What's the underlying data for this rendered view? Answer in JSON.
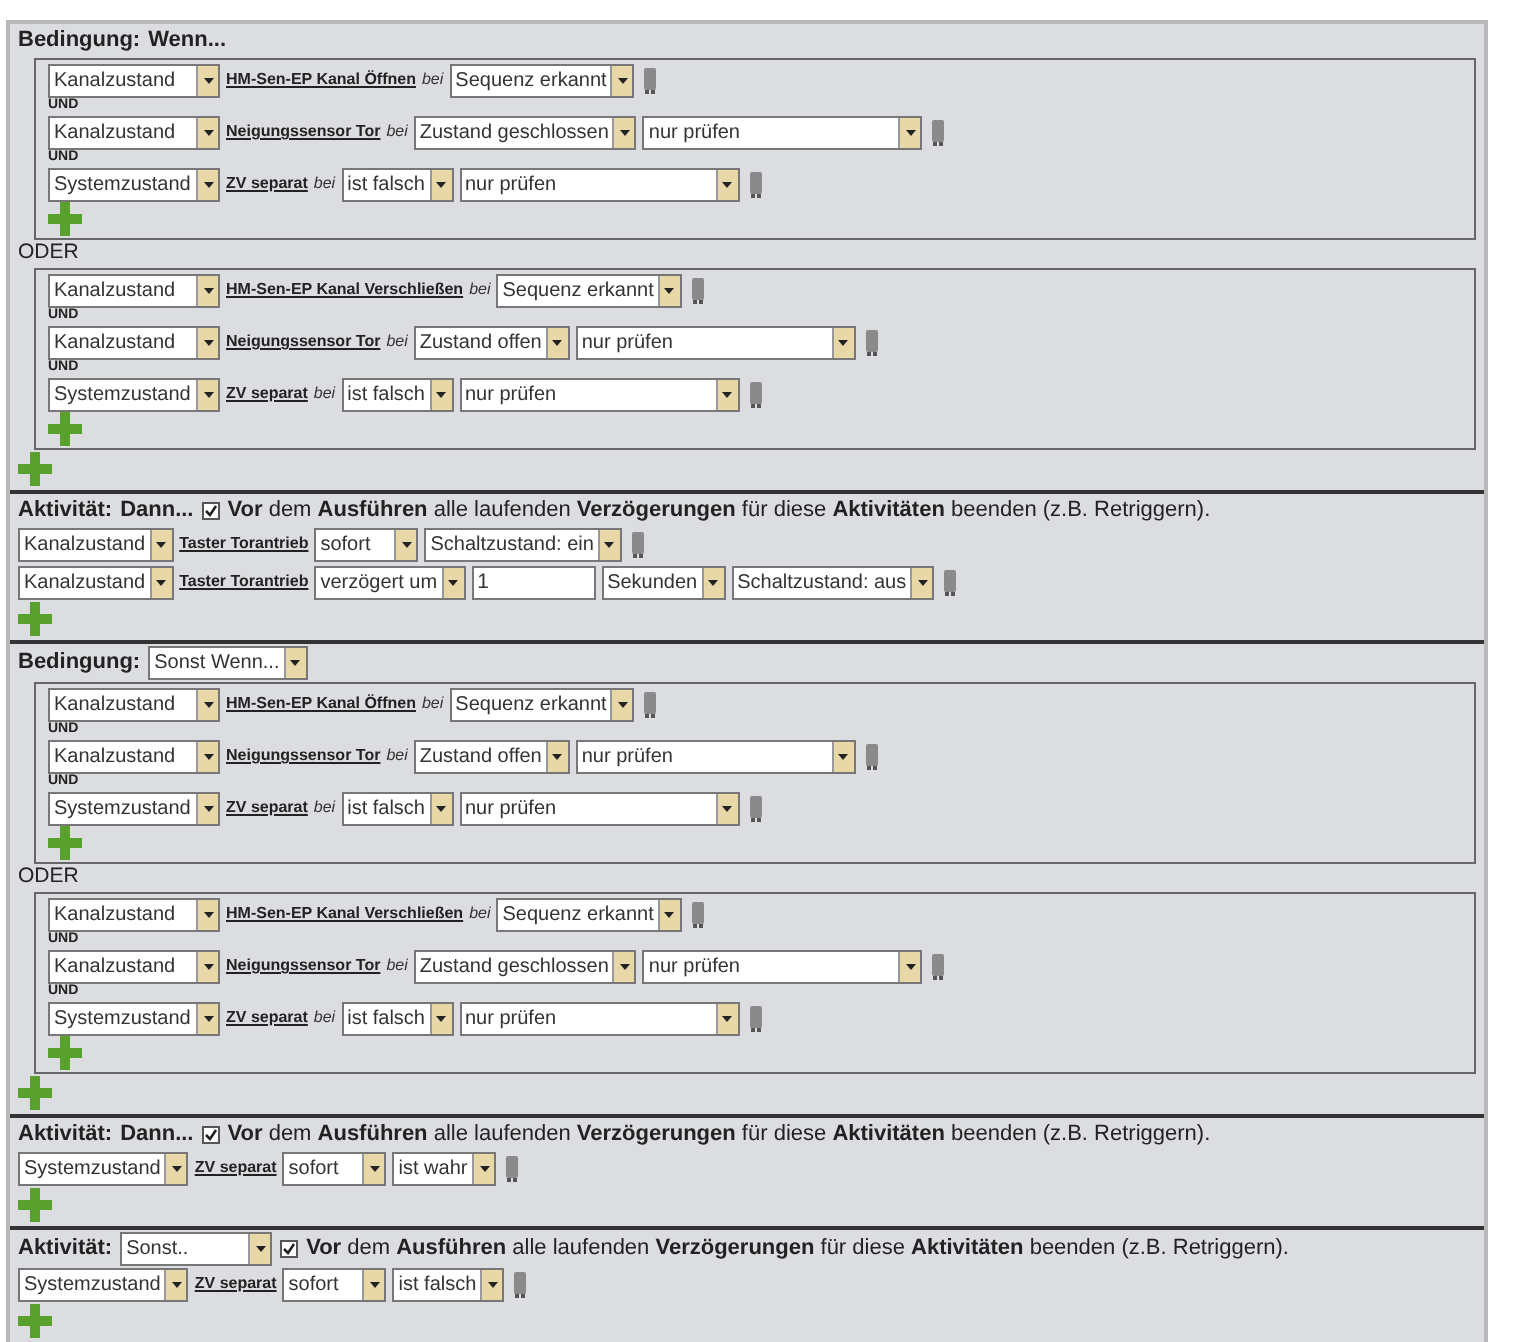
{
  "sections": [
    {
      "kind": "condition",
      "label": "Bedingung:",
      "mode": {
        "kind": "text",
        "value": "Wenn..."
      },
      "groups": [
        {
          "rows": [
            {
              "items": [
                {
                  "kind": "select",
                  "value": "Kanalzustand"
                },
                {
                  "kind": "link",
                  "text": "HM-Sen-EP Kanal Öffnen"
                },
                {
                  "kind": "note",
                  "text": "bei"
                },
                {
                  "kind": "select",
                  "value": "Sequenz erkannt"
                }
              ]
            },
            {
              "prefix": "UND",
              "items": [
                {
                  "kind": "select",
                  "value": "Kanalzustand"
                },
                {
                  "kind": "link",
                  "text": "Neigungssensor Tor"
                },
                {
                  "kind": "note",
                  "text": "bei"
                },
                {
                  "kind": "select",
                  "value": "Zustand geschlossen"
                },
                {
                  "kind": "select",
                  "value": "nur prüfen"
                }
              ]
            },
            {
              "prefix": "UND",
              "items": [
                {
                  "kind": "select",
                  "value": "Systemzustand"
                },
                {
                  "kind": "link",
                  "text": "ZV separat"
                },
                {
                  "kind": "note",
                  "text": "bei"
                },
                {
                  "kind": "select",
                  "value": "ist falsch"
                },
                {
                  "kind": "select",
                  "value": "nur prüfen"
                }
              ]
            }
          ]
        },
        {
          "prefix": "ODER",
          "rows": [
            {
              "items": [
                {
                  "kind": "select",
                  "value": "Kanalzustand"
                },
                {
                  "kind": "link",
                  "text": "HM-Sen-EP Kanal Verschließen"
                },
                {
                  "kind": "note",
                  "text": "bei"
                },
                {
                  "kind": "select",
                  "value": "Sequenz erkannt"
                }
              ]
            },
            {
              "prefix": "UND",
              "items": [
                {
                  "kind": "select",
                  "value": "Kanalzustand"
                },
                {
                  "kind": "link",
                  "text": "Neigungssensor Tor"
                },
                {
                  "kind": "note",
                  "text": "bei"
                },
                {
                  "kind": "select",
                  "value": "Zustand offen"
                },
                {
                  "kind": "select",
                  "value": "nur prüfen"
                }
              ]
            },
            {
              "prefix": "UND",
              "items": [
                {
                  "kind": "select",
                  "value": "Systemzustand"
                },
                {
                  "kind": "link",
                  "text": "ZV separat"
                },
                {
                  "kind": "note",
                  "text": "bei"
                },
                {
                  "kind": "select",
                  "value": "ist falsch"
                },
                {
                  "kind": "select",
                  "value": "nur prüfen"
                }
              ]
            }
          ]
        }
      ]
    },
    {
      "kind": "activity",
      "label": "Aktivität:",
      "mode": {
        "kind": "text",
        "value": "Dann..."
      },
      "checked": true,
      "note": "**Vor** dem **Ausführen** alle laufenden **Verzögerungen** für diese **Aktivitäten** beenden (z.B. Retriggern).",
      "rows": [
        {
          "items": [
            {
              "kind": "select",
              "value": "Kanalzustand"
            },
            {
              "kind": "link",
              "text": "Taster Torantrieb"
            },
            {
              "kind": "select",
              "value": "sofort"
            },
            {
              "kind": "select",
              "value": "Schaltzustand: ein"
            }
          ]
        },
        {
          "items": [
            {
              "kind": "select",
              "value": "Kanalzustand"
            },
            {
              "kind": "link",
              "text": "Taster Torantrieb"
            },
            {
              "kind": "select",
              "value": "verzögert um"
            },
            {
              "kind": "input",
              "value": "1"
            },
            {
              "kind": "select",
              "value": "Sekunden"
            },
            {
              "kind": "select",
              "value": "Schaltzustand: aus"
            }
          ]
        }
      ]
    },
    {
      "kind": "condition",
      "label": "Bedingung:",
      "mode": {
        "kind": "select",
        "value": "Sonst Wenn..."
      },
      "groups": [
        {
          "rows": [
            {
              "items": [
                {
                  "kind": "select",
                  "value": "Kanalzustand"
                },
                {
                  "kind": "link",
                  "text": "HM-Sen-EP Kanal Öffnen"
                },
                {
                  "kind": "note",
                  "text": "bei"
                },
                {
                  "kind": "select",
                  "value": "Sequenz erkannt"
                }
              ]
            },
            {
              "prefix": "UND",
              "items": [
                {
                  "kind": "select",
                  "value": "Kanalzustand"
                },
                {
                  "kind": "link",
                  "text": "Neigungssensor Tor"
                },
                {
                  "kind": "note",
                  "text": "bei"
                },
                {
                  "kind": "select",
                  "value": "Zustand offen"
                },
                {
                  "kind": "select",
                  "value": "nur prüfen"
                }
              ]
            },
            {
              "prefix": "UND",
              "items": [
                {
                  "kind": "select",
                  "value": "Systemzustand"
                },
                {
                  "kind": "link",
                  "text": "ZV separat"
                },
                {
                  "kind": "note",
                  "text": "bei"
                },
                {
                  "kind": "select",
                  "value": "ist falsch"
                },
                {
                  "kind": "select",
                  "value": "nur prüfen"
                }
              ]
            }
          ]
        },
        {
          "prefix": "ODER",
          "rows": [
            {
              "items": [
                {
                  "kind": "select",
                  "value": "Kanalzustand"
                },
                {
                  "kind": "link",
                  "text": "HM-Sen-EP Kanal Verschließen"
                },
                {
                  "kind": "note",
                  "text": "bei"
                },
                {
                  "kind": "select",
                  "value": "Sequenz erkannt"
                }
              ]
            },
            {
              "prefix": "UND",
              "items": [
                {
                  "kind": "select",
                  "value": "Kanalzustand"
                },
                {
                  "kind": "link",
                  "text": "Neigungssensor Tor"
                },
                {
                  "kind": "note",
                  "text": "bei"
                },
                {
                  "kind": "select",
                  "value": "Zustand geschlossen"
                },
                {
                  "kind": "select",
                  "value": "nur prüfen"
                }
              ]
            },
            {
              "prefix": "UND",
              "items": [
                {
                  "kind": "select",
                  "value": "Systemzustand"
                },
                {
                  "kind": "link",
                  "text": "ZV separat"
                },
                {
                  "kind": "note",
                  "text": "bei"
                },
                {
                  "kind": "select",
                  "value": "ist falsch"
                },
                {
                  "kind": "select",
                  "value": "nur prüfen"
                }
              ]
            }
          ]
        }
      ]
    },
    {
      "kind": "activity",
      "label": "Aktivität:",
      "mode": {
        "kind": "text",
        "value": "Dann..."
      },
      "checked": true,
      "note": "**Vor** dem **Ausführen** alle laufenden **Verzögerungen** für diese **Aktivitäten** beenden (z.B. Retriggern).",
      "rows": [
        {
          "items": [
            {
              "kind": "select",
              "value": "Systemzustand"
            },
            {
              "kind": "link",
              "text": "ZV separat"
            },
            {
              "kind": "select",
              "value": "sofort"
            },
            {
              "kind": "select",
              "value": "ist wahr"
            }
          ]
        }
      ]
    },
    {
      "kind": "activity",
      "label": "Aktivität:",
      "mode": {
        "kind": "select",
        "value": "Sonst.."
      },
      "checked": true,
      "note": "**Vor** dem **Ausführen** alle laufenden **Verzögerungen** für diese **Aktivitäten** beenden (z.B. Retriggern).",
      "rows": [
        {
          "items": [
            {
              "kind": "select",
              "value": "Systemzustand"
            },
            {
              "kind": "link",
              "text": "ZV separat"
            },
            {
              "kind": "select",
              "value": "sofort"
            },
            {
              "kind": "select",
              "value": "ist falsch"
            }
          ]
        }
      ]
    }
  ]
}
